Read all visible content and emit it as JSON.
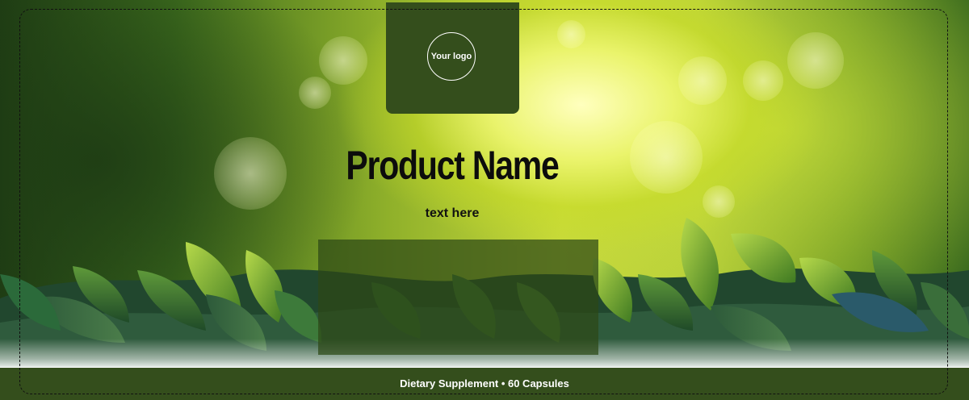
{
  "logo": {
    "text": "Your logo"
  },
  "product": {
    "name": "Product Name",
    "subtitle": "text here"
  },
  "footer": {
    "text": "Dietary Supplement • 60 Capsules"
  },
  "colors": {
    "brand_dark_green": "#344e1c",
    "panel_green": "#2c4816",
    "title_text": "#0c0c0c",
    "footer_text": "#ffffff"
  }
}
